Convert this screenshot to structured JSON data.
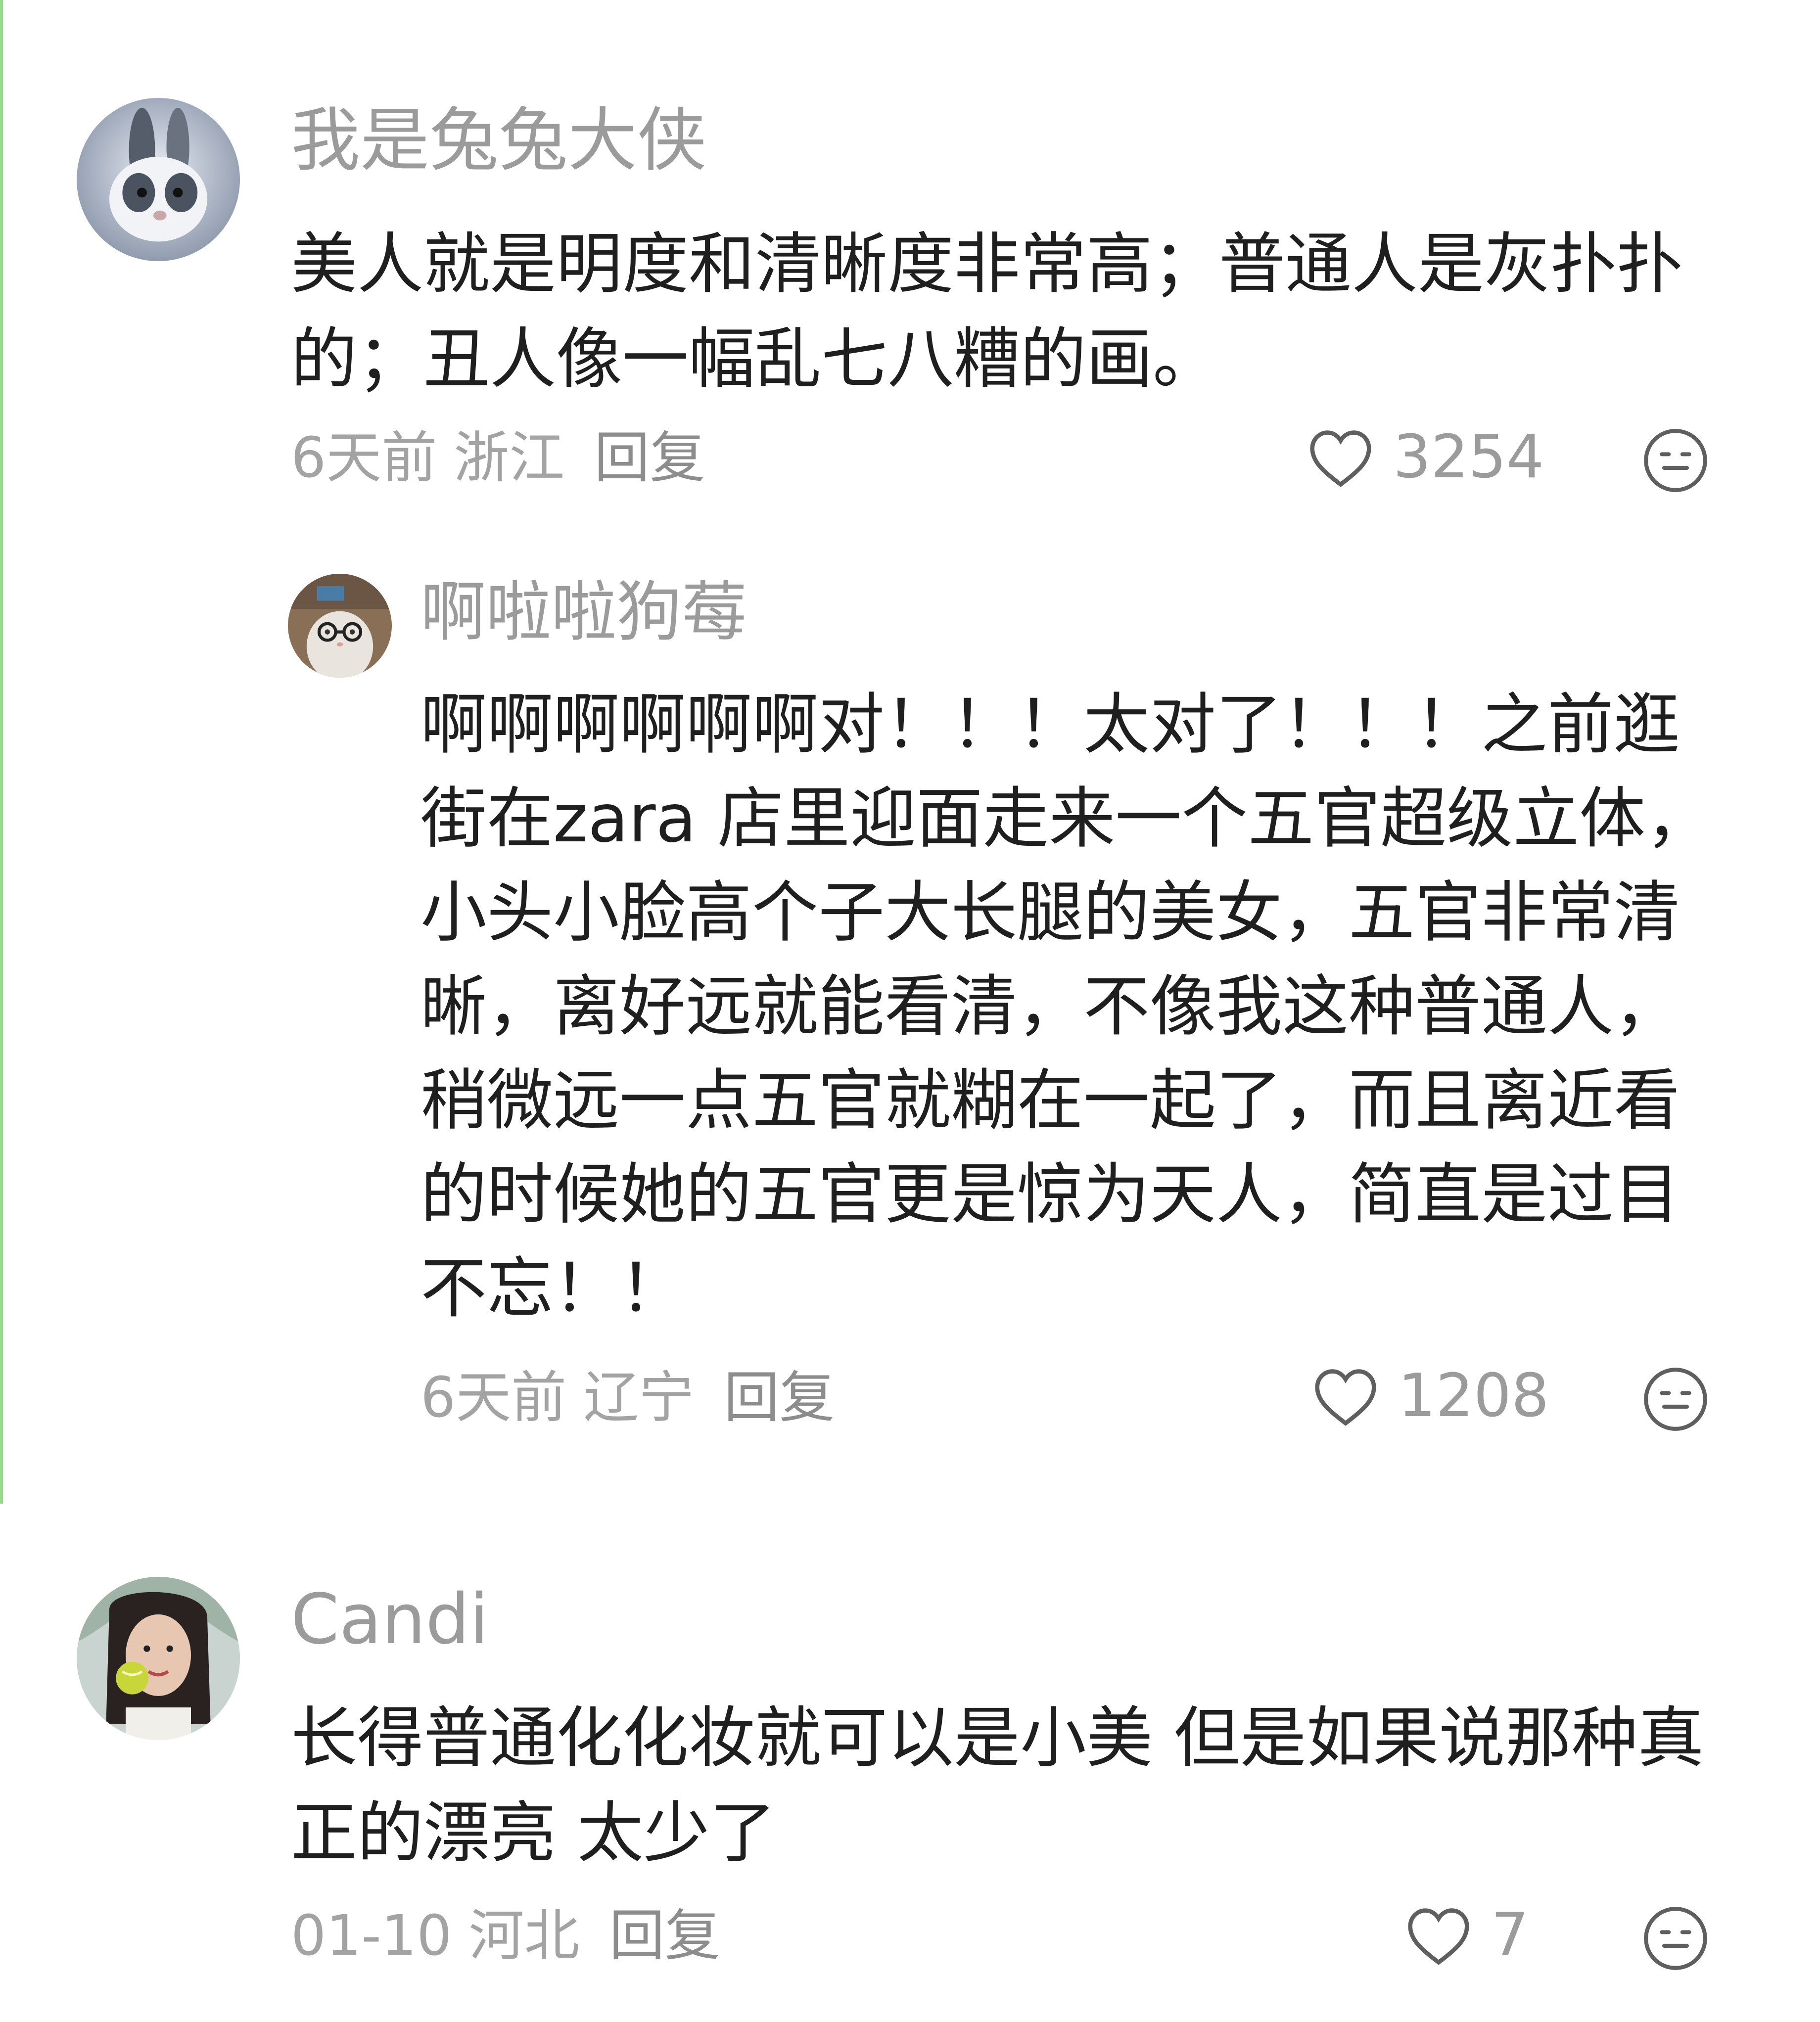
{
  "comments": [
    {
      "username": "我是兔兔大侠",
      "text": "美人就是明度和清晰度非常高；普通人是灰扑扑的；丑人像一幅乱七八糟的画。",
      "time": "6天前",
      "region": "浙江",
      "reply_label": "回复",
      "likes": "3254",
      "avatar": "rabbit-avatar",
      "replies": [
        {
          "username": "啊啦啦狗莓",
          "text": "啊啊啊啊啊啊对！！！太对了！！！之前逛街在zara 店里迎面走来一个五官超级立体，小头小脸高个子大长腿的美女，五官非常清晰，离好远就能看清，不像我这种普通人，稍微远一点五官就糊在一起了，而且离近看的时候她的五官更是惊为天人，简直是过目不忘！！",
          "time": "6天前",
          "region": "辽宁",
          "reply_label": "回复",
          "likes": "1208",
          "avatar": "cat-with-glasses-avatar"
        }
      ]
    },
    {
      "username": "Candi",
      "text": "长得普通化化妆就可以是小美 但是如果说那种真正的漂亮 太少了",
      "time": "01-10",
      "region": "河北",
      "reply_label": "回复",
      "likes": "7",
      "avatar": "woman-with-ball-avatar"
    }
  ],
  "icons": {
    "like": "heart-outline-icon",
    "dislike": "neutral-face-icon"
  },
  "colors": {
    "username": "#9b9b9b",
    "text": "#1f1f1f",
    "meta": "#a3a3a3",
    "side_line": "#93db86"
  }
}
